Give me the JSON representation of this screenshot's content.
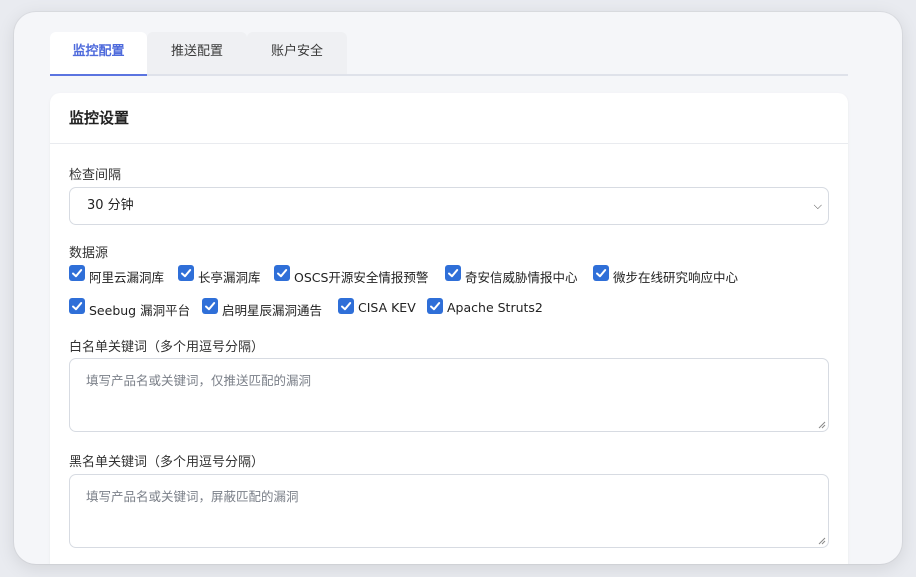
{
  "tabs": [
    {
      "label": "监控配置",
      "active": true
    },
    {
      "label": "推送配置",
      "active": false
    },
    {
      "label": "账户安全",
      "active": false
    }
  ],
  "card": {
    "title": "监控设置",
    "interval": {
      "label": "检查间隔",
      "value": "30 分钟"
    },
    "sources": {
      "label": "数据源",
      "items": [
        {
          "label": "阿里云漏洞库",
          "checked": true
        },
        {
          "label": "长亭漏洞库",
          "checked": true
        },
        {
          "label": "OSCS开源安全情报预警",
          "checked": true
        },
        {
          "label": "奇安信威胁情报中心",
          "checked": true
        },
        {
          "label": "微步在线研究响应中心",
          "checked": true
        },
        {
          "label": "Seebug 漏洞平台",
          "checked": true
        },
        {
          "label": "启明星辰漏洞通告",
          "checked": true
        },
        {
          "label": "CISA KEV",
          "checked": true
        },
        {
          "label": "Apache Struts2",
          "checked": true
        }
      ]
    },
    "whitelist": {
      "label": "白名单关键词（多个用逗号分隔）",
      "placeholder": "填写产品名或关键词，仅推送匹配的漏洞"
    },
    "blacklist": {
      "label": "黑名单关键词（多个用逗号分隔）",
      "placeholder": "填写产品名或关键词，屏蔽匹配的漏洞"
    }
  },
  "colors": {
    "accent": "#4f6bdc",
    "checkbox": "#2f6fd8"
  }
}
